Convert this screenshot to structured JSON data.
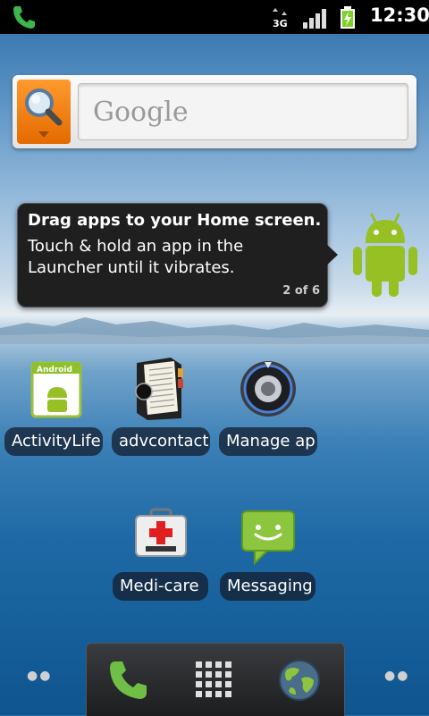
{
  "status_bar": {
    "time": "12:30",
    "network": "3G"
  },
  "search": {
    "placeholder": "Google"
  },
  "tip": {
    "title": "Drag apps to your Home screen.",
    "body": "Touch & hold an app in the Launcher until it vibrates.",
    "page": "2 of 6"
  },
  "apps": {
    "row1": [
      {
        "label": "ActivityLife"
      },
      {
        "label": "advcontact"
      },
      {
        "label": "Manage ap"
      }
    ],
    "row2": [
      {
        "label": "Medi-care"
      },
      {
        "label": "Messaging"
      }
    ]
  },
  "colors": {
    "accent_orange": "#f28a10",
    "android_green": "#97c024"
  }
}
